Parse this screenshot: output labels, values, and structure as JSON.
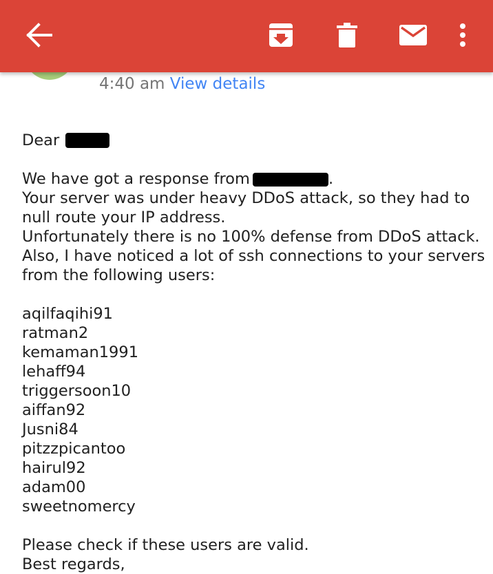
{
  "toolbar": {
    "back_icon": "arrow-back-icon",
    "archive_icon": "archive-icon",
    "delete_icon": "trash-icon",
    "mark_unread_icon": "mail-icon",
    "more_icon": "more-vert-icon",
    "background_color": "#db4437"
  },
  "header": {
    "time": "4:40 am",
    "view_details": "View details"
  },
  "message": {
    "greeting": "Dear",
    "line1_prefix": "We have got a response from",
    "line1_suffix": ".",
    "line2": "Your server was under heavy DDoS attack, so they had to",
    "line3": "null route your IP address.",
    "line4": "Unfortunately there is no 100% defense from DDoS attack.",
    "line5": "Also, I have noticed a lot of ssh connections to your servers",
    "line6": "from the following users:",
    "users": [
      "aqilfaqihi91",
      "ratman2",
      "kemaman1991",
      "lehaff94",
      "triggersoon10",
      "aiffan92",
      "Jusni84",
      "pitzzpicantoo",
      "hairul92",
      "adam00",
      "sweetnomercy"
    ],
    "closing1": "Please check if these users are valid.",
    "closing2": "Best regards,"
  },
  "colors": {
    "link": "#4285f4",
    "meta_text": "#757575",
    "avatar": "#a6cc7a"
  }
}
